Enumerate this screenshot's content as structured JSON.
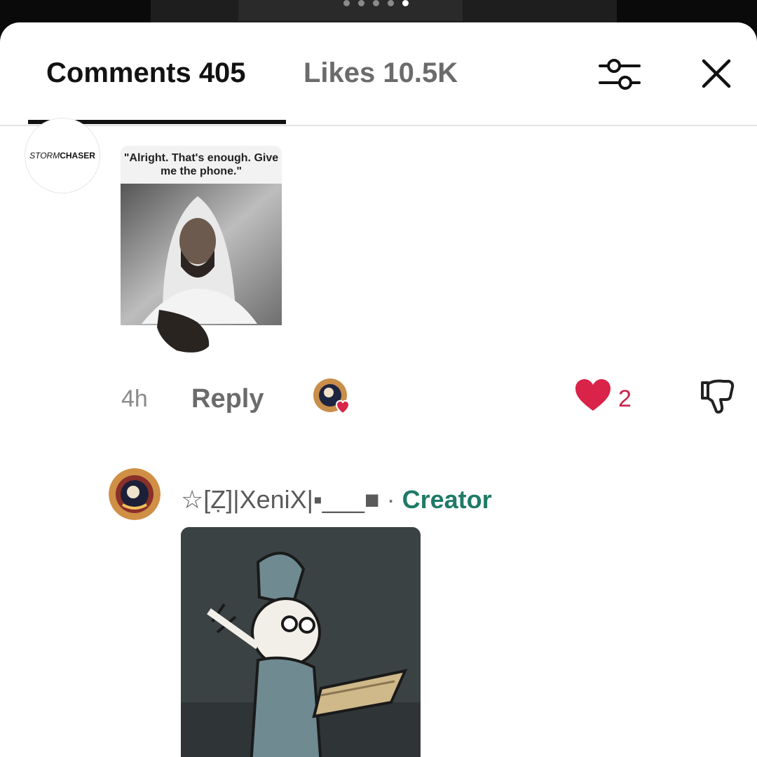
{
  "video_pager": {
    "dots": 5,
    "active_index": 4
  },
  "header": {
    "comments_label": "Comments 405",
    "likes_label": "Likes 10.5K",
    "filter_icon": "sliders-icon",
    "close_icon": "close-icon"
  },
  "comment1": {
    "avatar_text_1": "STORM",
    "avatar_text_2": "CHASER",
    "image_caption": "\"Alright. That's enough. Give me the phone.\"",
    "time": "4h",
    "reply_label": "Reply",
    "like_count": "2",
    "liked_by_creator_icon": "creator-heart-avatar-icon",
    "like_icon": "heart-icon",
    "dislike_icon": "thumbs-down-icon"
  },
  "comment2": {
    "username": "☆[Ẓ]|XeniX|▪___■",
    "separator": " · ",
    "badge": "Creator"
  },
  "colors": {
    "accent_heart": "#d92349",
    "creator_badge": "#1f7a66",
    "sheet_bg": "#ffffff"
  }
}
